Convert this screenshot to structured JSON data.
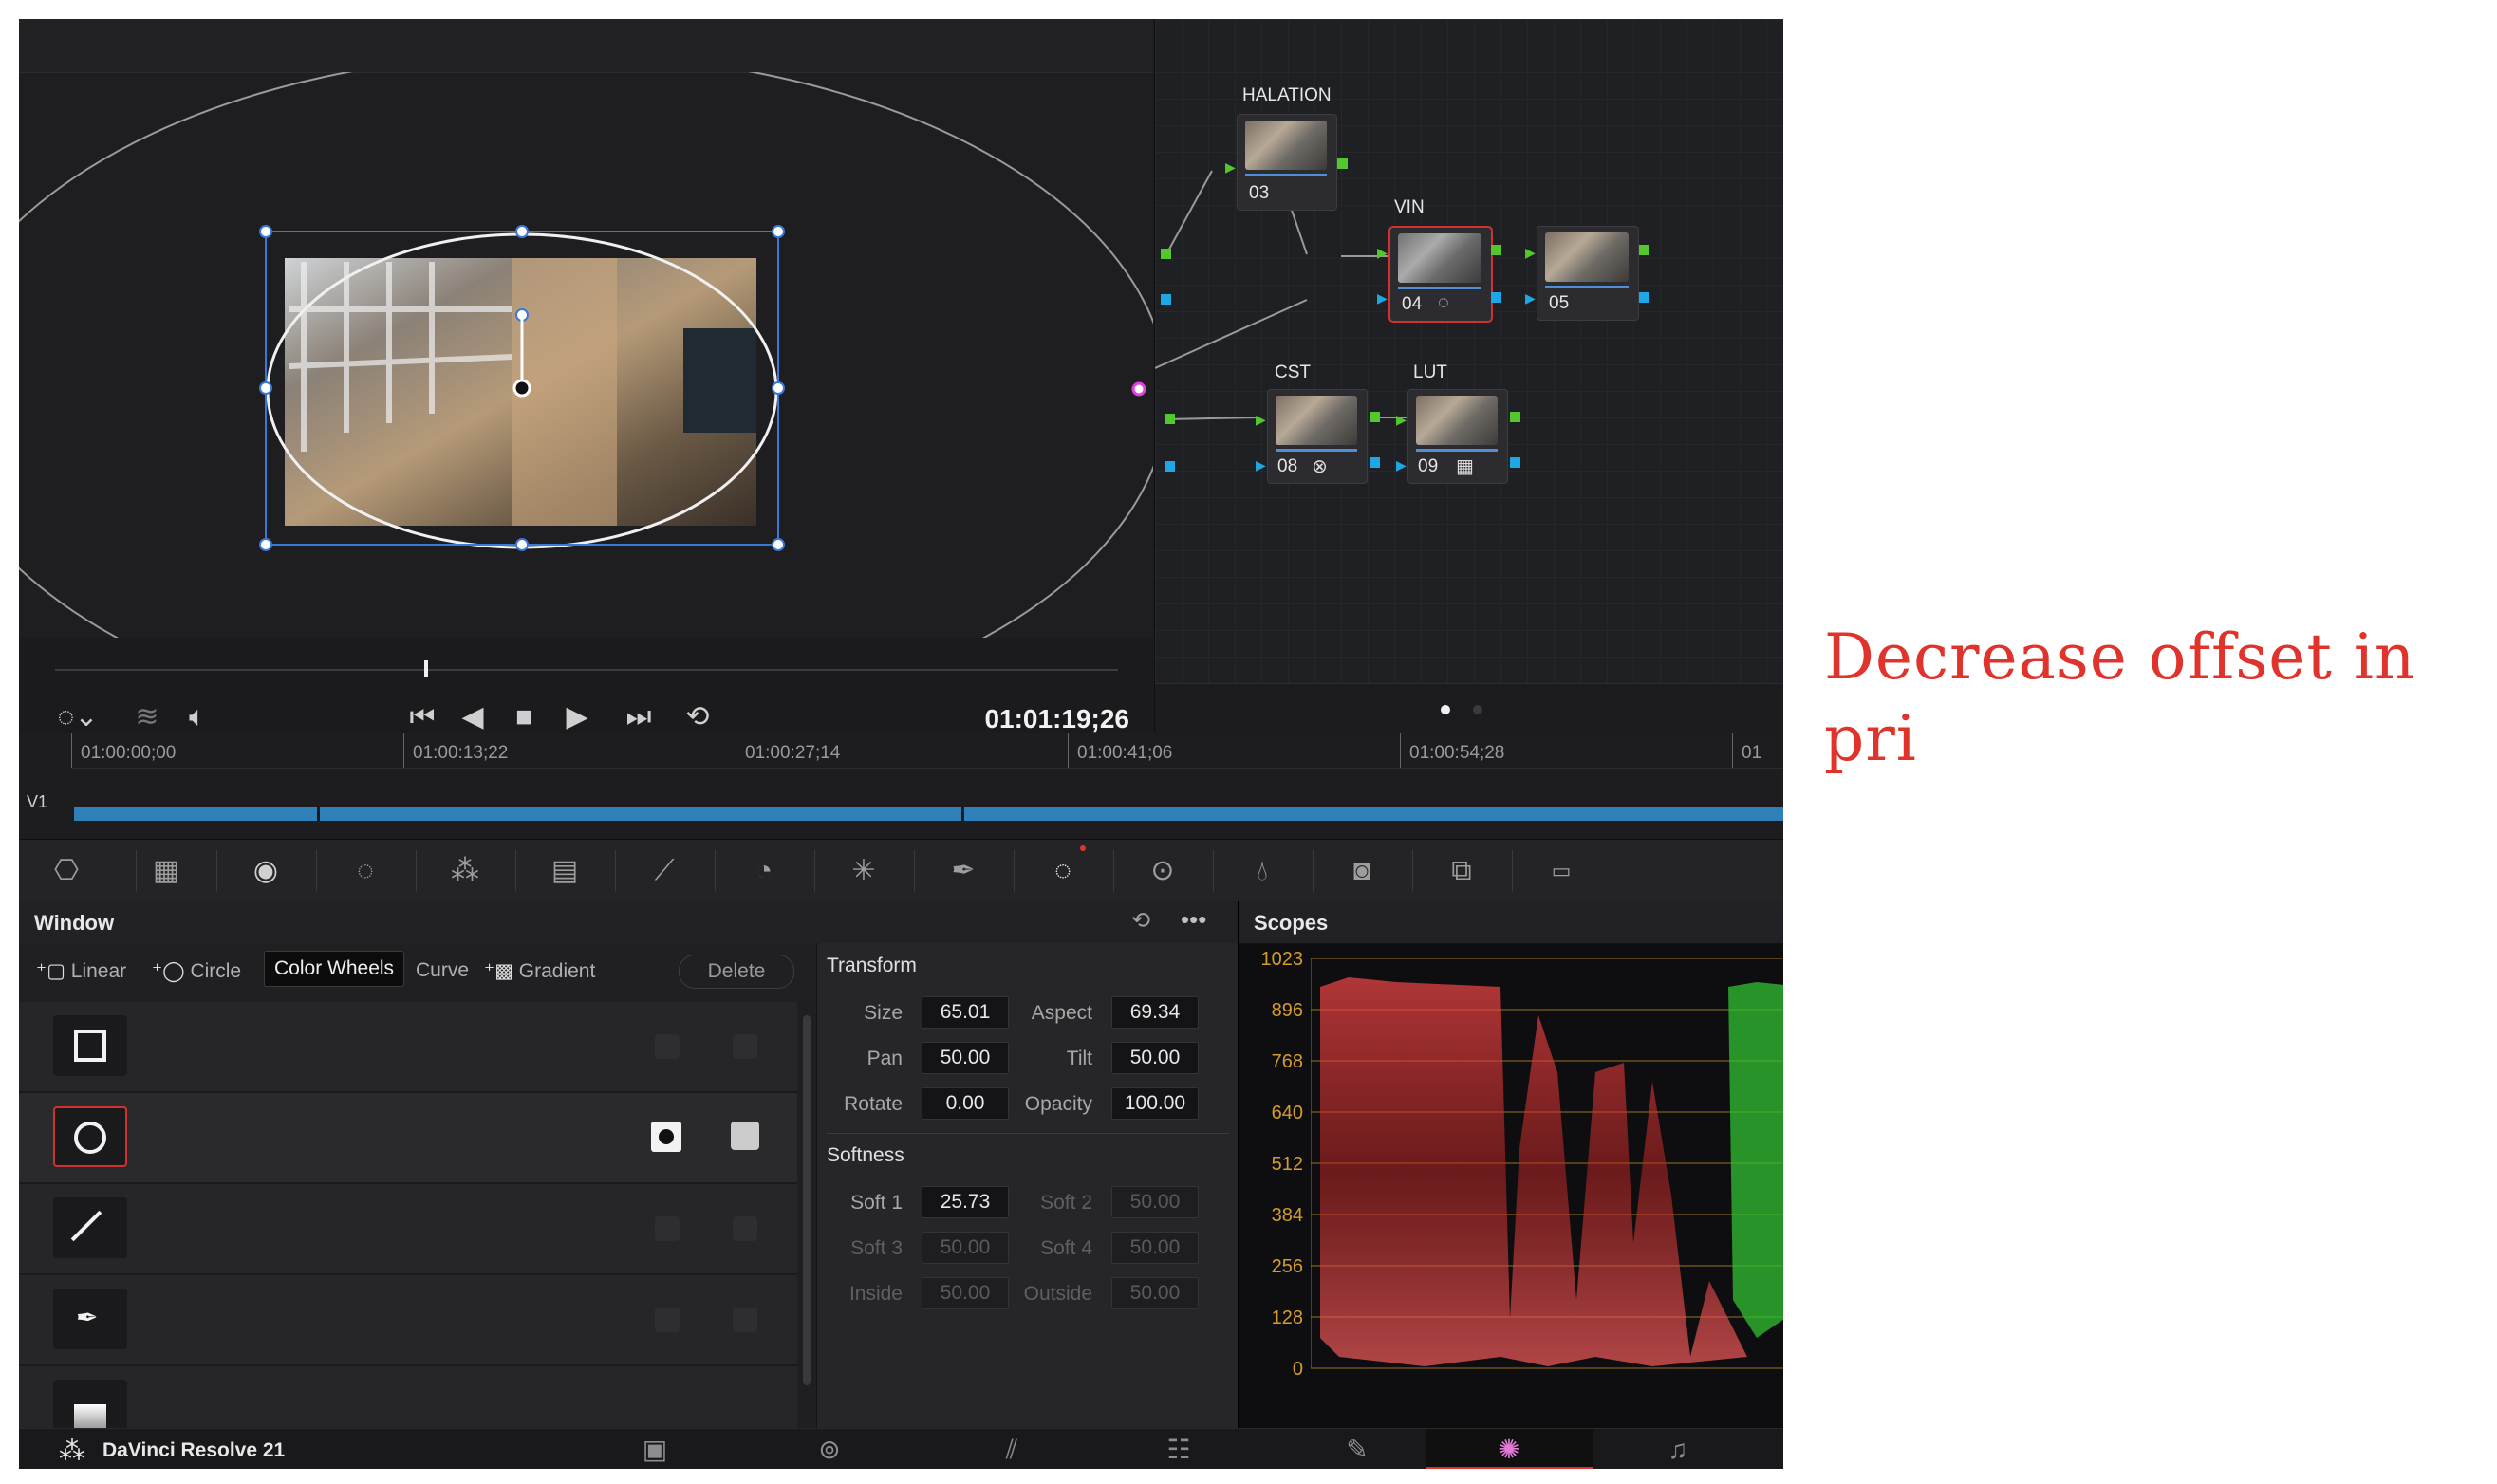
{
  "annotation": {
    "text": "Decrease offset in pri"
  },
  "viewer": {
    "timecode": "01:01:19;26"
  },
  "nodes": [
    {
      "label": "HALATION",
      "num": "03"
    },
    {
      "label": "VIN",
      "num": "04"
    },
    {
      "label": "",
      "num": "05"
    },
    {
      "label": "CST",
      "num": "08"
    },
    {
      "label": "LUT",
      "num": "09"
    }
  ],
  "timeline": {
    "track": "V1",
    "ticks": [
      "01:00:00;00",
      "01:00:13;22",
      "01:00:27;14",
      "01:00:41;06",
      "01:00:54;28",
      "01"
    ]
  },
  "window_panel": {
    "title": "Window",
    "shapes": [
      "Linear",
      "Circle",
      "Curve",
      "Gradient"
    ],
    "delete_label": "Delete",
    "tooltip": "Color Wheels"
  },
  "transform": {
    "title": "Transform",
    "fields": [
      {
        "label": "Size",
        "value": "65.01"
      },
      {
        "label": "Aspect",
        "value": "69.34"
      },
      {
        "label": "Pan",
        "value": "50.00"
      },
      {
        "label": "Tilt",
        "value": "50.00"
      },
      {
        "label": "Rotate",
        "value": "0.00"
      },
      {
        "label": "Opacity",
        "value": "100.00"
      }
    ],
    "softness_title": "Softness",
    "softness": [
      {
        "label": "Soft 1",
        "value": "25.73"
      },
      {
        "label": "Soft 2",
        "value": "50.00"
      },
      {
        "label": "Soft 3",
        "value": "50.00"
      },
      {
        "label": "Soft 4",
        "value": "50.00"
      },
      {
        "label": "Inside",
        "value": "50.00"
      },
      {
        "label": "Outside",
        "value": "50.00"
      }
    ]
  },
  "scopes": {
    "title": "Scopes",
    "yticks": [
      "1023",
      "896",
      "768",
      "640",
      "512",
      "384",
      "256",
      "128",
      "0"
    ]
  },
  "bottombar": {
    "app_name": "DaVinci Resolve 21"
  },
  "colors": {
    "accent_red": "#e0332c",
    "port_green": "#54c72c",
    "port_blue": "#1fa6e6",
    "scope_axis": "#d69c29",
    "selection_blue": "#3a78d8"
  }
}
